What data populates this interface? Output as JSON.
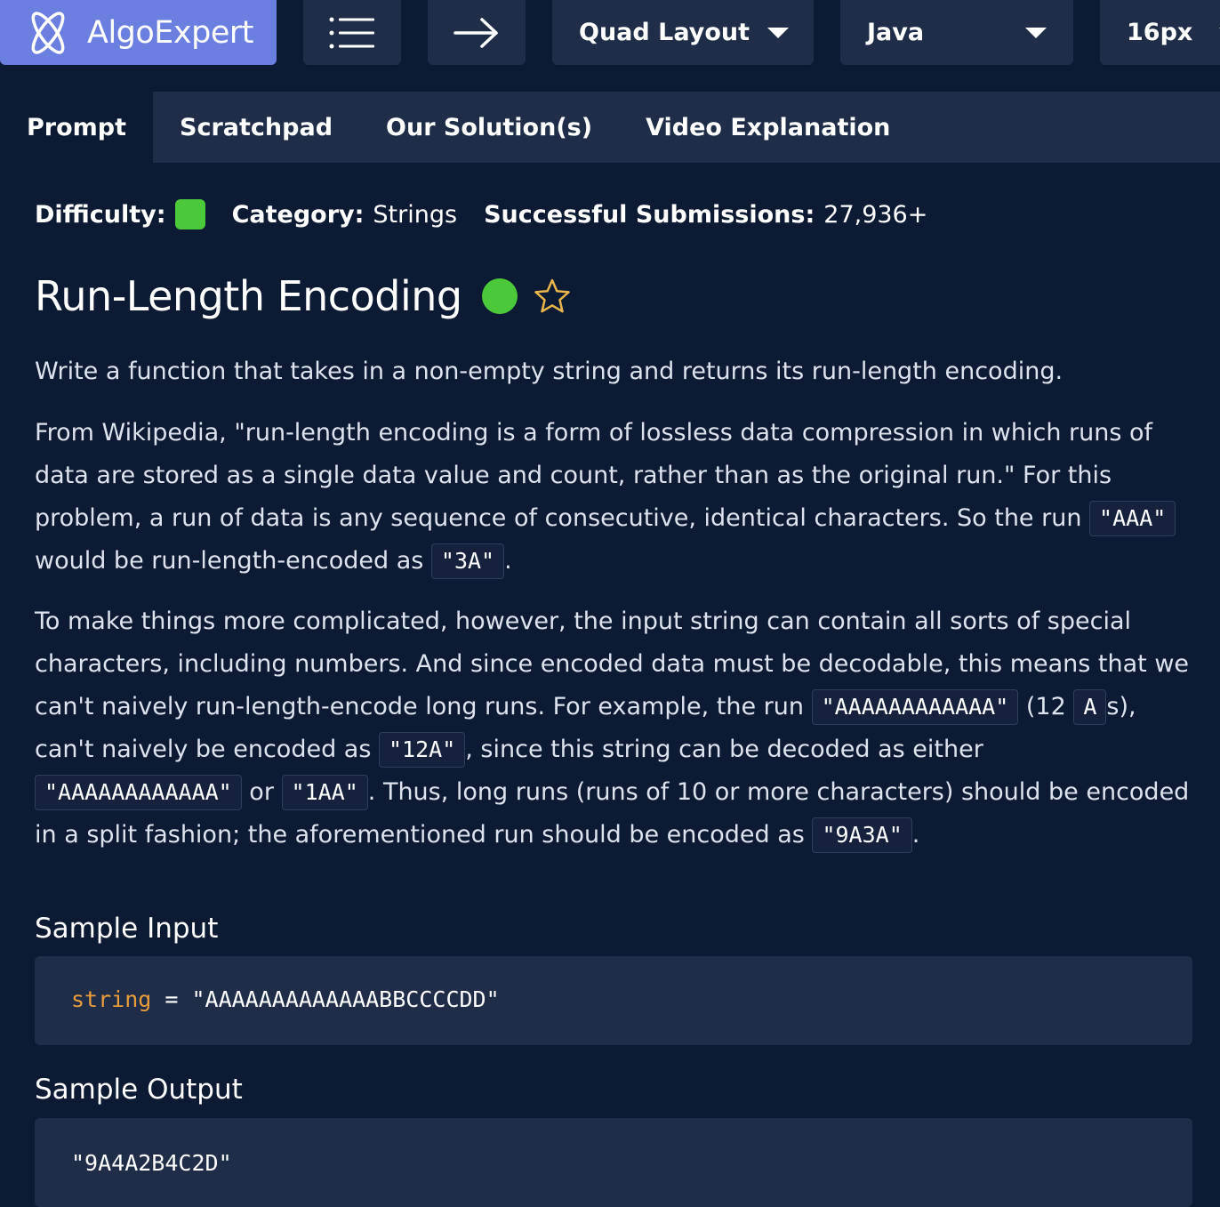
{
  "toolbar": {
    "brand": "AlgoExpert",
    "layout_label": "Quad Layout",
    "language_label": "Java",
    "font_size_label": "16px",
    "icons": [
      "algoexpert-logo-icon",
      "list-icon",
      "arrow-right-icon",
      "chevron-down-icon"
    ]
  },
  "tabs": [
    {
      "label": "Prompt",
      "active": true
    },
    {
      "label": "Scratchpad",
      "active": false
    },
    {
      "label": "Our Solution(s)",
      "active": false
    },
    {
      "label": "Video Explanation",
      "active": false
    }
  ],
  "meta": {
    "difficulty_label": "Difficulty:",
    "category_label": "Category:",
    "category_value": "Strings",
    "submissions_label": "Successful Submissions:",
    "submissions_value": "27,936+",
    "difficulty_color": "#4cc93a"
  },
  "problem": {
    "title": "Run-Length Encoding",
    "p1": "Write a function that takes in a non-empty string and returns its run-length encoding.",
    "p2": {
      "t1": "From Wikipedia, \"run-length encoding is a form of lossless data compression in which runs of data are stored as a single data value and count, rather than as the original run.\" For this problem, a run of data is any sequence of consecutive, identical characters. So the run ",
      "c1": "\"AAA\"",
      "t2": " would be run-length-encoded as ",
      "c2": "\"3A\"",
      "t3": "."
    },
    "p3": {
      "t1": "To make things more complicated, however, the input string can contain all sorts of special characters, including numbers. And since encoded data must be decodable, this means that we can't naively run-length-encode long runs. For example, the run ",
      "c1": "\"AAAAAAAAAAAA\"",
      "t2": " (12 ",
      "c2": "A",
      "t3": "s), can't naively be encoded as ",
      "c3": "\"12A\"",
      "t4": ", since this string can be decoded as either ",
      "c4": "\"AAAAAAAAAAAA\"",
      "t5": " or ",
      "c5": "\"1AA\"",
      "t6": ". Thus, long runs (runs of 10 or more characters) should be encoded in a split fashion; the aforementioned run should be encoded as ",
      "c6": "\"9A3A\"",
      "t7": "."
    }
  },
  "sample_input": {
    "heading": "Sample Input",
    "var": "string",
    "op": " = ",
    "value": "\"AAAAAAAAAAAAABBCCCCDD\""
  },
  "sample_output": {
    "heading": "Sample Output",
    "value": "\"9A4A2B4C2D\""
  }
}
